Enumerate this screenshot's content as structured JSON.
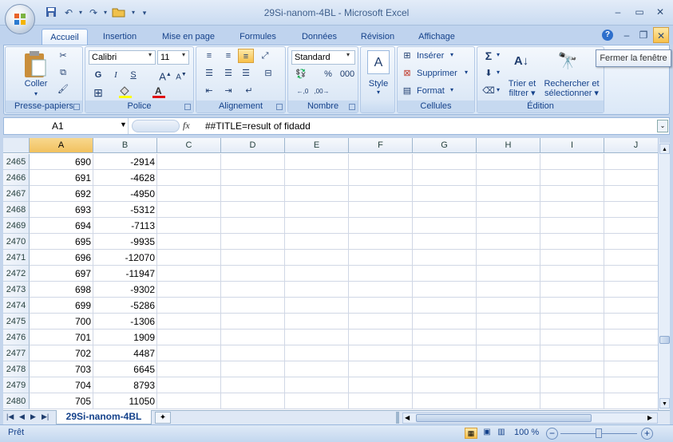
{
  "window": {
    "title": "29Si-nanom-4BL - Microsoft Excel",
    "close_tooltip": "Fermer la fenêtre"
  },
  "tabs": [
    "Accueil",
    "Insertion",
    "Mise en page",
    "Formules",
    "Données",
    "Révision",
    "Affichage"
  ],
  "ribbon": {
    "clipboard": {
      "label": "Presse-papiers",
      "paste": "Coller"
    },
    "font": {
      "label": "Police",
      "name": "Calibri",
      "size": "11",
      "bold": "G",
      "italic": "I",
      "underline": "S"
    },
    "alignment": {
      "label": "Alignement"
    },
    "number": {
      "label": "Nombre",
      "format": "Standard",
      "percent": "%",
      "thousands": "000"
    },
    "style": {
      "label": "Style"
    },
    "cells": {
      "label": "Cellules",
      "insert": "Insérer",
      "delete": "Supprimer",
      "format": "Format"
    },
    "editing": {
      "label": "Édition",
      "sort_l1": "Trier et",
      "sort_l2": "filtrer",
      "find_l1": "Rechercher et",
      "find_l2": "sélectionner"
    }
  },
  "formula_bar": {
    "name_box": "A1",
    "fx": "fx",
    "content": "##TITLE=result of fidadd"
  },
  "columns": [
    "A",
    "B",
    "C",
    "D",
    "E",
    "F",
    "G",
    "H",
    "I",
    "J"
  ],
  "rows": [
    {
      "n": "2465",
      "a": "690",
      "b": "-2914"
    },
    {
      "n": "2466",
      "a": "691",
      "b": "-4628"
    },
    {
      "n": "2467",
      "a": "692",
      "b": "-4950"
    },
    {
      "n": "2468",
      "a": "693",
      "b": "-5312"
    },
    {
      "n": "2469",
      "a": "694",
      "b": "-7113"
    },
    {
      "n": "2470",
      "a": "695",
      "b": "-9935"
    },
    {
      "n": "2471",
      "a": "696",
      "b": "-12070"
    },
    {
      "n": "2472",
      "a": "697",
      "b": "-11947"
    },
    {
      "n": "2473",
      "a": "698",
      "b": "-9302"
    },
    {
      "n": "2474",
      "a": "699",
      "b": "-5286"
    },
    {
      "n": "2475",
      "a": "700",
      "b": "-1306"
    },
    {
      "n": "2476",
      "a": "701",
      "b": "1909"
    },
    {
      "n": "2477",
      "a": "702",
      "b": "4487"
    },
    {
      "n": "2478",
      "a": "703",
      "b": "6645"
    },
    {
      "n": "2479",
      "a": "704",
      "b": "8793"
    },
    {
      "n": "2480",
      "a": "705",
      "b": "11050"
    }
  ],
  "sheet_tab": "29Si-nanom-4BL",
  "status": {
    "ready": "Prêt",
    "zoom": "100 %"
  }
}
